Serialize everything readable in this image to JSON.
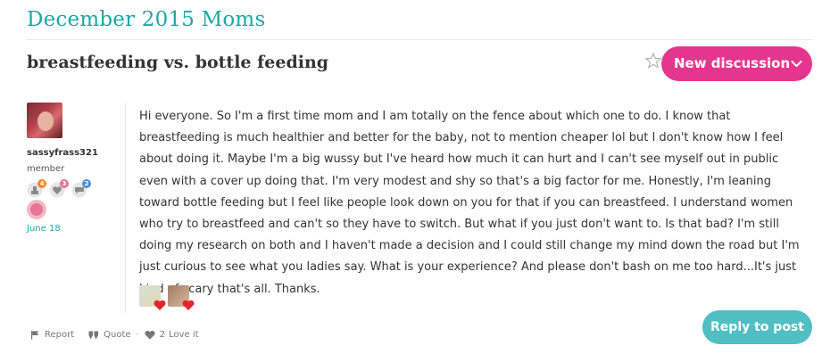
{
  "group": {
    "title": "December 2015 Moms"
  },
  "thread": {
    "title": "breastfeeding vs. bottle feeding"
  },
  "header": {
    "new_discussion_label": "New discussion"
  },
  "author": {
    "username": "sassyfrass321",
    "role": "member",
    "badges": [
      {
        "icon": "trophy-icon",
        "count": "4",
        "color": "#f08a24"
      },
      {
        "icon": "heart-icon",
        "count": "3",
        "color": "#e96f9a"
      },
      {
        "icon": "speech-bubble-icon",
        "count": "2",
        "color": "#4a90d9"
      }
    ],
    "joined": "June 18"
  },
  "post": {
    "body": "Hi everyone. So I'm a first time mom and I am totally on the fence about which one to do. I know that breastfeeding is much healthier and better for the baby, not to mention cheaper lol but I don't know how I feel about doing it. Maybe I'm a big wussy but I've heard how much it can hurt and I can't see myself out in public even with a cover up doing that. I'm very modest and shy so that's a big factor for me. Honestly, I'm leaning toward bottle feeding but I feel like people look down on you for that if you can breastfeed. I understand women who try to breastfeed and can't so they have to switch. But what if you just don't want to. Is that bad? I'm still doing my research on both and I haven't made a decision and I could still change my mind down the road but I'm just curious to see what you ladies say. What is your experience? And please don't bash on me too hard...It's just kind of scary that's all. Thanks."
  },
  "actions": {
    "report_label": "Report",
    "quote_label": "Quote",
    "separator": "·",
    "love_count": "2",
    "love_label": "Love it"
  },
  "reply": {
    "label": "Reply to post"
  },
  "colors": {
    "brand_teal": "#1aa9a4",
    "accent_pink": "#e5368d",
    "reply_teal": "#4fbfc3"
  }
}
